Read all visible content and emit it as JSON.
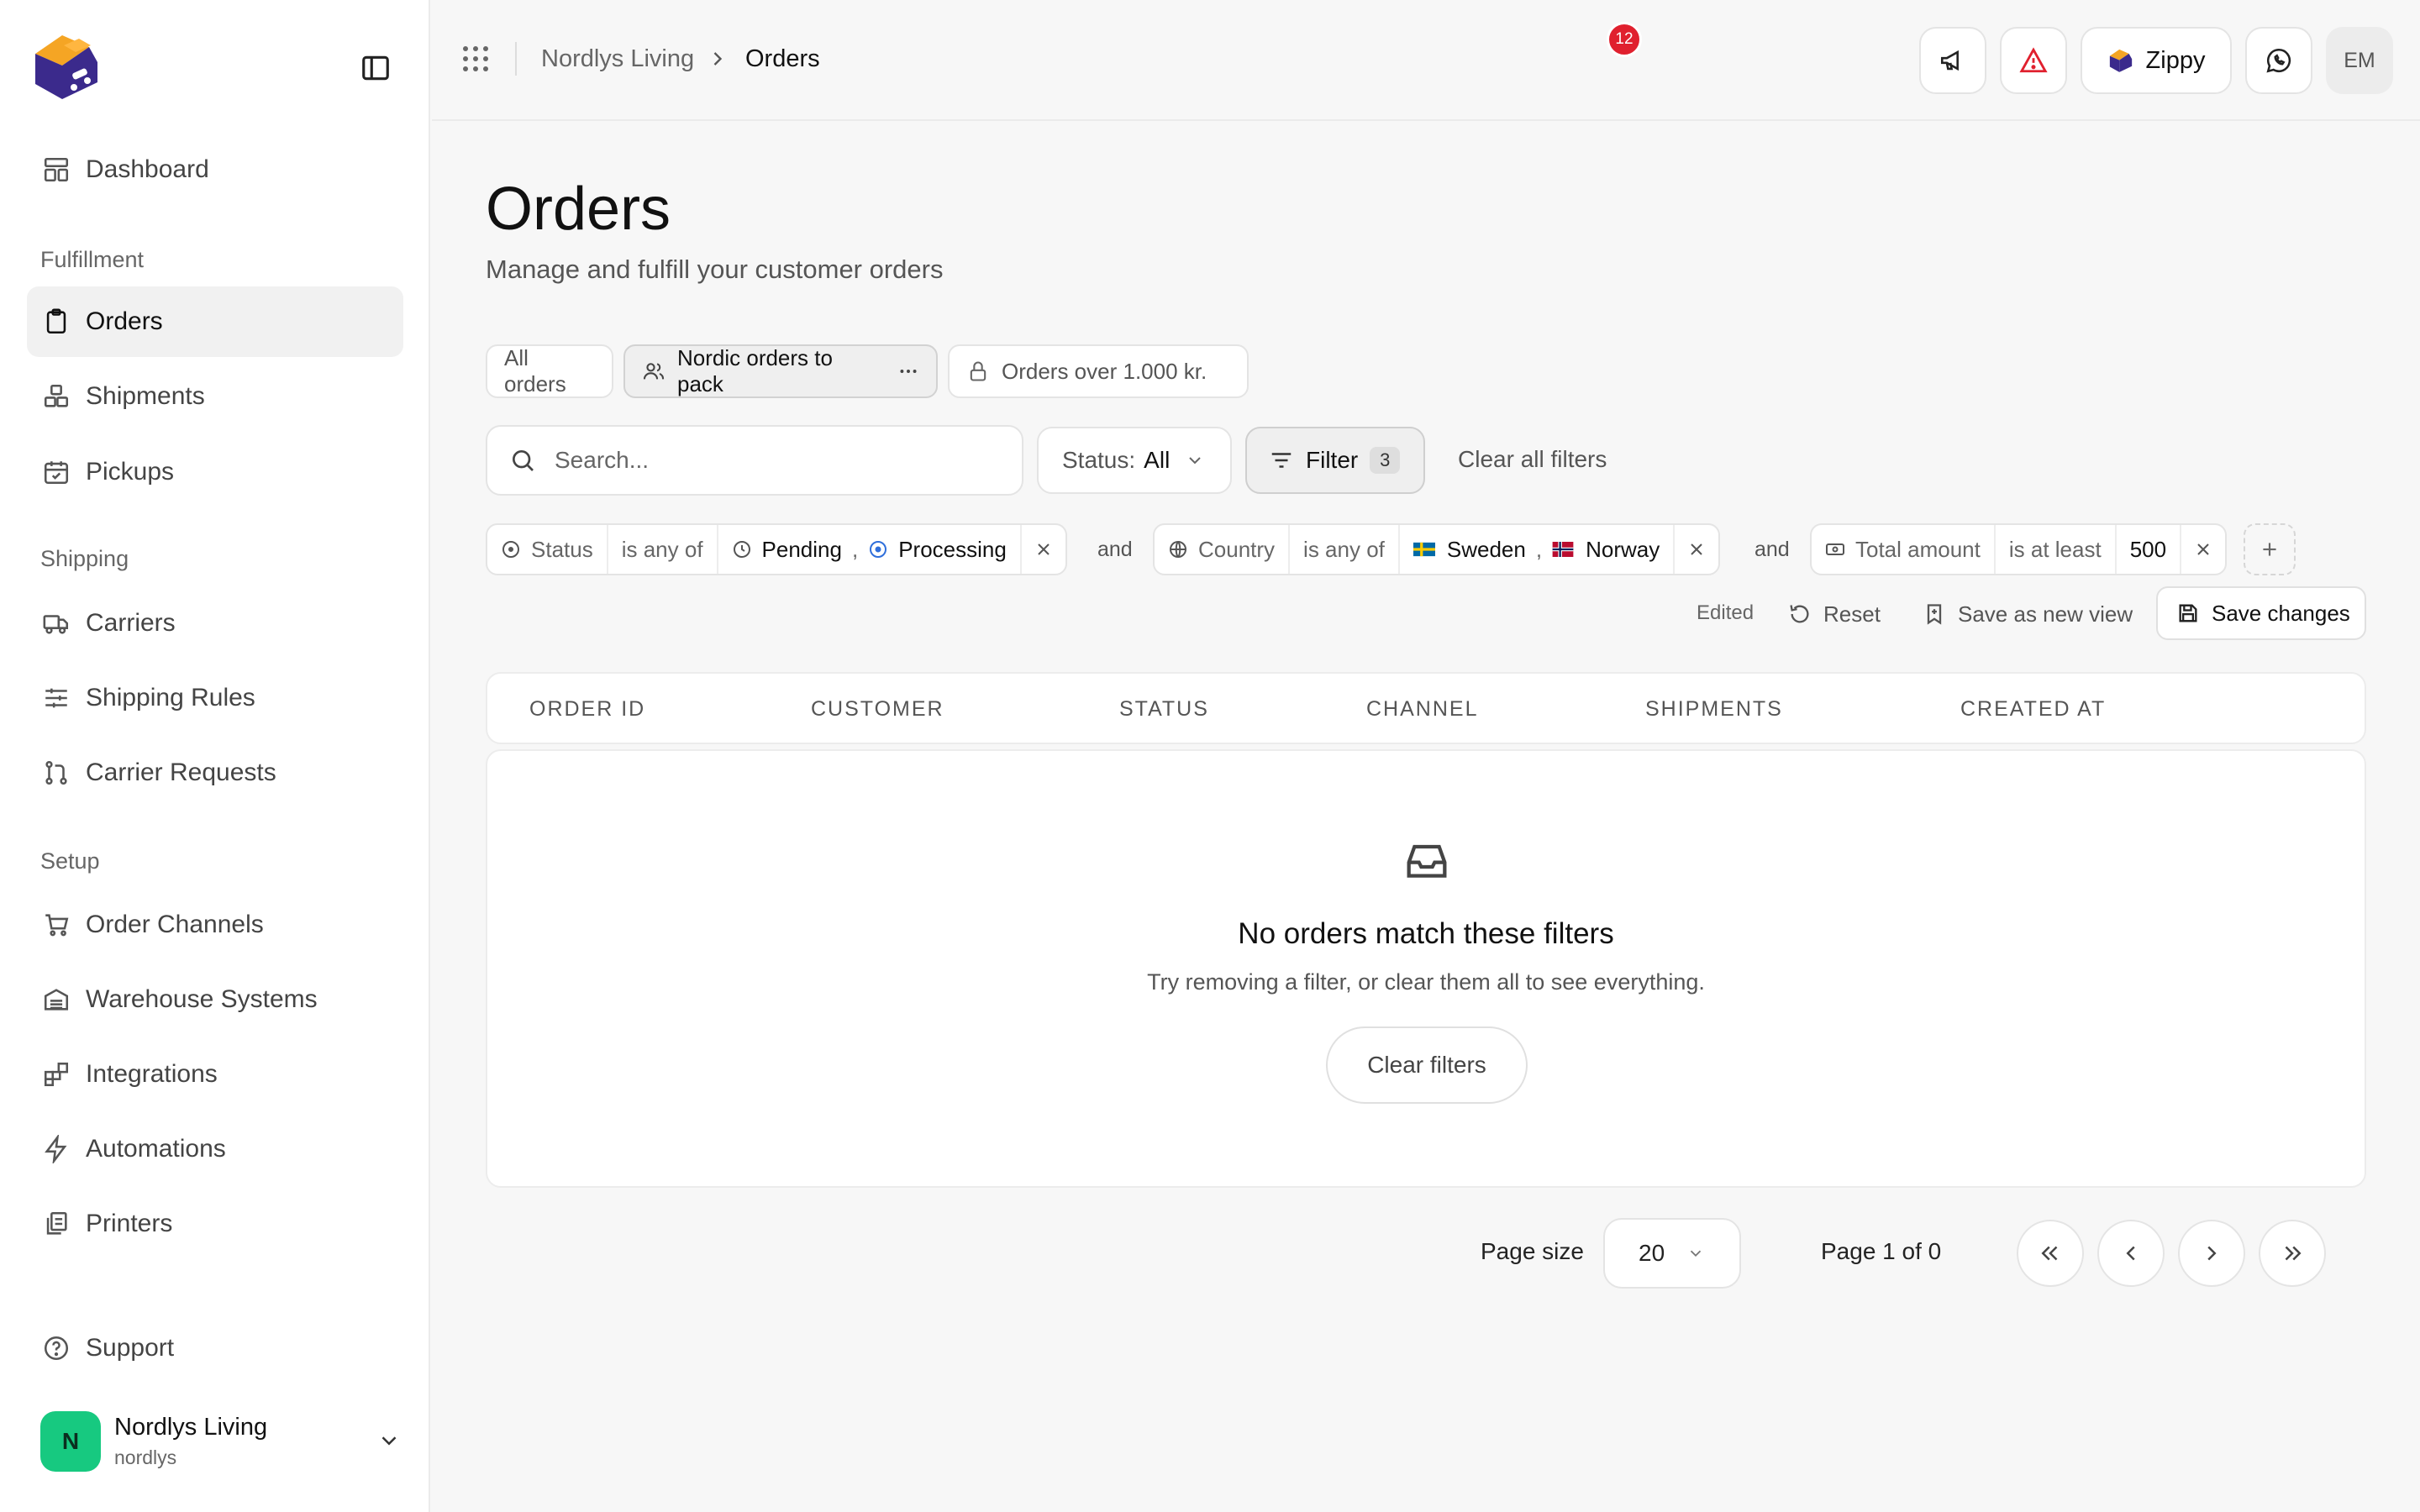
{
  "sidebar": {
    "nav_dashboard": "Dashboard",
    "section_fulfillment": "Fulfillment",
    "nav_orders": "Orders",
    "nav_shipments": "Shipments",
    "nav_pickups": "Pickups",
    "section_shipping": "Shipping",
    "nav_carriers": "Carriers",
    "nav_shipping_rules": "Shipping Rules",
    "nav_carrier_requests": "Carrier Requests",
    "section_setup": "Setup",
    "nav_order_channels": "Order Channels",
    "nav_warehouse_systems": "Warehouse Systems",
    "nav_integrations": "Integrations",
    "nav_automations": "Automations",
    "nav_printers": "Printers",
    "nav_support": "Support",
    "account": {
      "initial": "N",
      "name": "Nordlys Living",
      "slug": "nordlys"
    }
  },
  "header": {
    "breadcrumb_root": "Nordlys Living",
    "breadcrumb_current": "Orders",
    "alert_count": "12",
    "workspace_label": "Zippy",
    "user_initials": "EM"
  },
  "page": {
    "title": "Orders",
    "subtitle": "Manage and fulfill your customer orders"
  },
  "views": {
    "all": "All orders",
    "nordic": "Nordic orders to pack",
    "over": "Orders over 1.000 kr."
  },
  "toolbar": {
    "search_placeholder": "Search...",
    "status_label": "Status:",
    "status_value": "All",
    "filter_label": "Filter",
    "filter_count": "3",
    "clear_all": "Clear all filters"
  },
  "filters": {
    "and": "and",
    "status": {
      "field": "Status",
      "op": "is any of",
      "v1": "Pending",
      "sep": ",",
      "v2": "Processing"
    },
    "country": {
      "field": "Country",
      "op": "is any of",
      "v1": "Sweden",
      "sep": ",",
      "v2": "Norway"
    },
    "amount": {
      "field": "Total amount",
      "op": "is at least",
      "value": "500"
    }
  },
  "view_actions": {
    "edited": "Edited",
    "reset": "Reset",
    "save_new": "Save as new view",
    "save_changes": "Save changes"
  },
  "table": {
    "columns": [
      "ORDER ID",
      "CUSTOMER",
      "STATUS",
      "CHANNEL",
      "SHIPMENTS",
      "CREATED AT"
    ],
    "empty_title": "No orders match these filters",
    "empty_sub": "Try removing a filter, or clear them all to see everything.",
    "empty_button": "Clear filters"
  },
  "pagination": {
    "page_size_label": "Page size",
    "page_size_value": "20",
    "page_info": "Page 1 of 0"
  },
  "colors": {
    "accent_green": "#17c980",
    "alert_red": "#e0202e",
    "logo_orange": "#f5a524",
    "logo_purple": "#3b2a8c"
  }
}
